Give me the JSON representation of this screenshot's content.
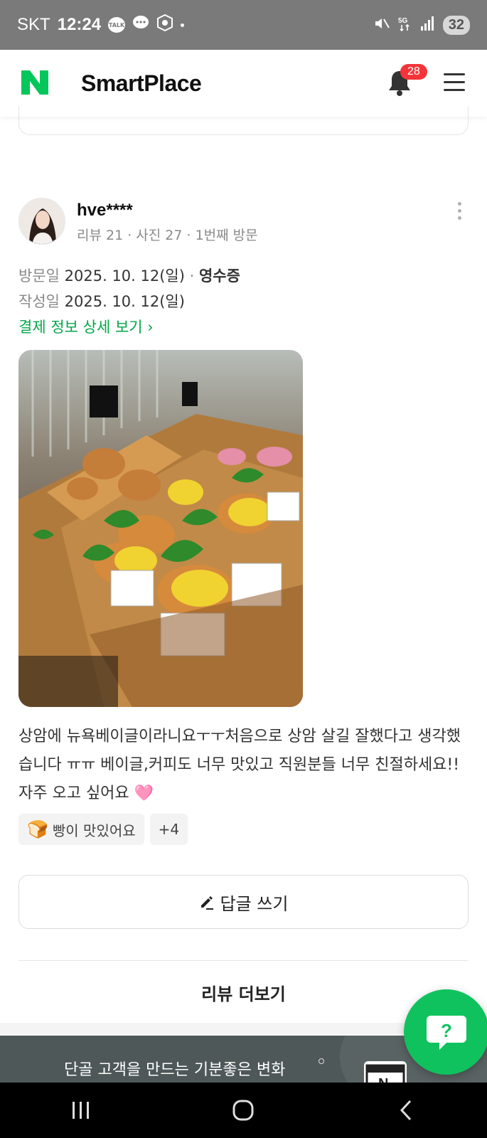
{
  "status_bar": {
    "carrier": "SKT",
    "time": "12:24",
    "talk_icon_label": "TALK",
    "battery": "32",
    "icons": [
      "kakaotalk-icon",
      "chat-bubble-icon",
      "app-shield-icon",
      "mute-icon",
      "5g-icon",
      "signal-icon",
      "battery-icon"
    ]
  },
  "header": {
    "brand": "SmartPlace",
    "notification_count": "28",
    "accent": "#03c75a"
  },
  "review": {
    "author": "hve****",
    "meta": "리뷰 21 · 사진 27 · 1번째 방문",
    "visit_label": "방문일",
    "visit_date": "2025. 10. 12(일)",
    "visit_sep": " · ",
    "receipt": "영수증",
    "written_label": "작성일",
    "written_date": "2025. 10. 12(일)",
    "payment_link": "결제 정보 상세 보기 ›",
    "text": "상암에 뉴욕베이글이라니요ㅜㅜ처음으로 상암 살길 잘했다고 생각했습니다 ㅠㅠ 베이글,커피도 너무 맛있고 직원분들 너무 친절하세요!! 자주 오고 싶어요 🩷",
    "tags": [
      {
        "icon": "🍞",
        "label": "빵이 맛있어요"
      }
    ],
    "more_tags": "+4"
  },
  "actions": {
    "reply": "답글 쓰기",
    "more_reviews": "리뷰 더보기"
  },
  "fab": {
    "label": "?"
  },
  "banner": {
    "text": "단골 고객을 만드는 기분좋은 변화"
  },
  "nav": {
    "items": [
      "recent-apps-icon",
      "home-icon",
      "back-icon"
    ]
  }
}
